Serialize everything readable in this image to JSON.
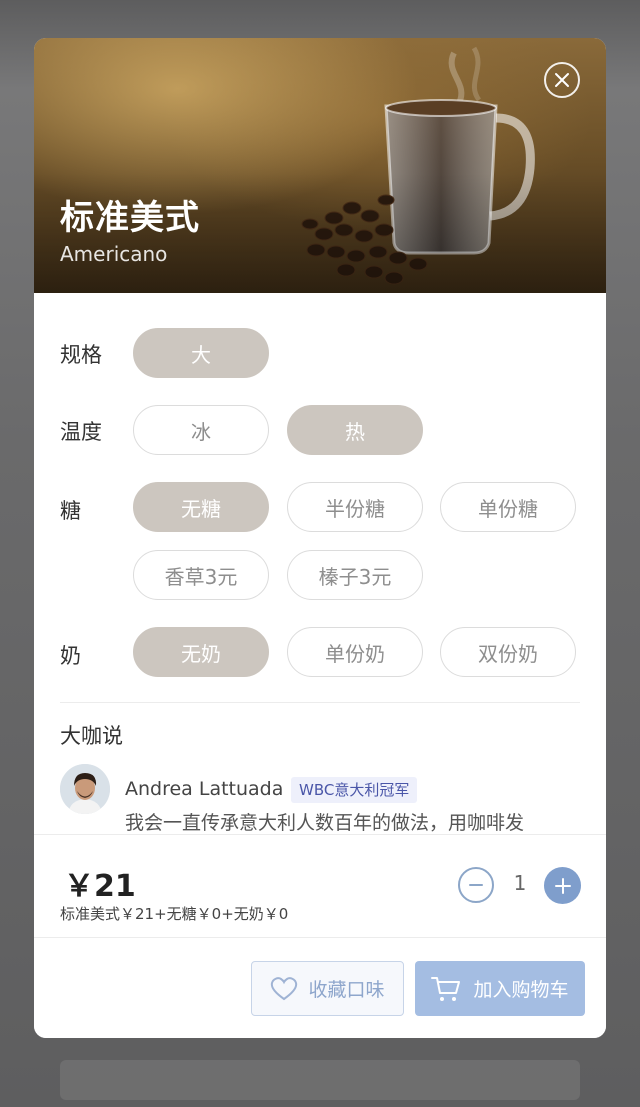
{
  "hero": {
    "title": "标准美式",
    "subtitle": "Americano",
    "close_icon": "close-icon"
  },
  "options": {
    "size": {
      "label": "规格",
      "choices": [
        "大"
      ],
      "selected": "大"
    },
    "temperature": {
      "label": "温度",
      "choices": [
        "冰",
        "热"
      ],
      "selected": "热"
    },
    "sugar": {
      "label": "糖",
      "choices": [
        "无糖",
        "半份糖",
        "单份糖",
        "香草3元",
        "榛子3元"
      ],
      "selected": "无糖"
    },
    "milk": {
      "label": "奶",
      "choices": [
        "无奶",
        "单份奶",
        "双份奶"
      ],
      "selected": "无奶"
    }
  },
  "barista": {
    "section_title": "大咖说",
    "name": "Andrea Lattuada",
    "badge": "WBC意大利冠军",
    "quote": "我会一直传承意大利人数百年的做法，用咖啡发"
  },
  "order": {
    "price": "￥21",
    "price_detail": "标准美式￥21+无糖￥0+无奶￥0",
    "quantity": "1"
  },
  "actions": {
    "favorite_label": "收藏口味",
    "add_to_cart_label": "加入购物车"
  },
  "colors": {
    "selected_pill": "#ccc6bf",
    "accent_blue": "#7f9ecc",
    "cart_button": "#a4bde2"
  }
}
